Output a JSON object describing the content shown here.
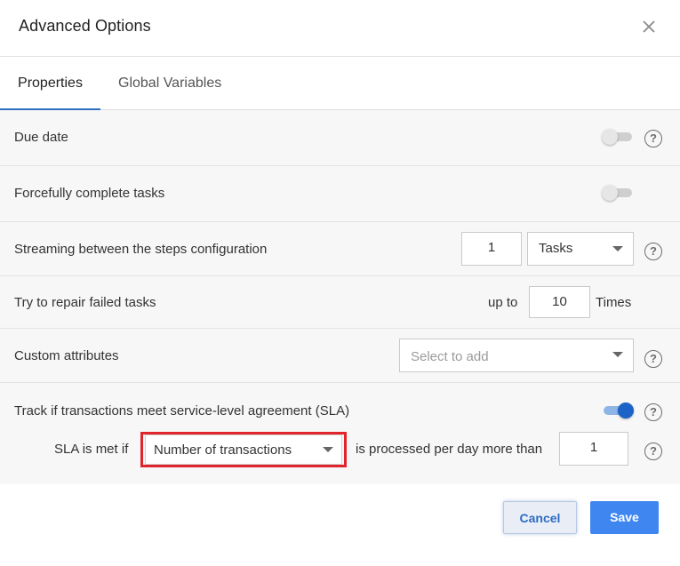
{
  "dialog": {
    "title": "Advanced Options",
    "close_icon": "close-icon"
  },
  "tabs": [
    {
      "label": "Properties",
      "active": true
    },
    {
      "label": "Global Variables",
      "active": false
    }
  ],
  "settings": {
    "due_date": {
      "label": "Due date",
      "enabled": false
    },
    "forceful": {
      "label": "Forcefully complete tasks",
      "enabled": false
    },
    "streaming": {
      "label": "Streaming between the steps configuration",
      "value": "1",
      "unit": "Tasks"
    },
    "repair": {
      "label": "Try to repair failed tasks",
      "prefix": "up to",
      "value": "10",
      "suffix": "Times"
    },
    "custom": {
      "label": "Custom attributes",
      "placeholder": "Select to add"
    },
    "sla": {
      "label": "Track if transactions meet service-level agreement (SLA)",
      "enabled": true,
      "met_if": "SLA is met if",
      "metric": "Number of transactions",
      "condition": "is processed per day more than",
      "threshold": "1"
    }
  },
  "footer": {
    "cancel": "Cancel",
    "save": "Save"
  },
  "colors": {
    "accent": "#1b63c6",
    "save_button": "#3f86f0",
    "highlight_box": "#e0252c"
  }
}
